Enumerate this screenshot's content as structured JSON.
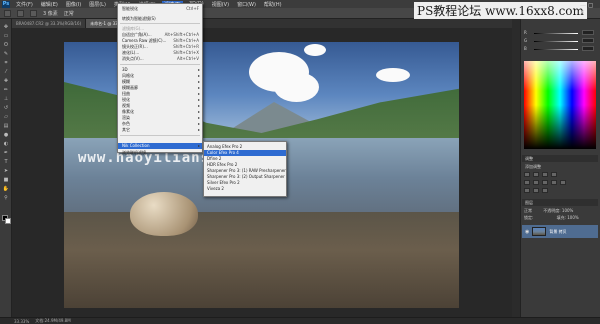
{
  "menubar": {
    "logo": "Ps",
    "items": [
      "文件(F)",
      "编辑(E)",
      "图像(I)",
      "图层(L)",
      "类型(Y)",
      "选择(S)",
      "滤镜(T)",
      "3D(D)",
      "视图(V)",
      "窗口(W)",
      "帮助(H)"
    ]
  },
  "options": {
    "sample_label": "3 像素",
    "size_label": "正常"
  },
  "doc_tabs": [
    "BRA0487.CR2 @ 33.3%(RGB/16)",
    "未命名-1 @ 33.3%(背景 拷贝, RGB/8)"
  ],
  "site_watermark": "PS教程论坛 www.16xx8.com",
  "window_buttons": "— ▢ ✕",
  "filter_menu": {
    "items": [
      {
        "label": "智能锐化",
        "shortcut": "Ctrl+F",
        "disabled": false
      },
      {
        "label": "转换为智能滤镜(S)",
        "shortcut": "",
        "disabled": false
      },
      {
        "label": "滤镜库(G)...",
        "shortcut": "",
        "disabled": true
      },
      {
        "label": "自适应广角(A)...",
        "shortcut": "Alt+Shift+Ctrl+A",
        "disabled": false
      },
      {
        "label": "Camera Raw 滤镜(C)...",
        "shortcut": "Shift+Ctrl+A",
        "disabled": false
      },
      {
        "label": "镜头校正(R)...",
        "shortcut": "Shift+Ctrl+R",
        "disabled": false
      },
      {
        "label": "液化(L)...",
        "shortcut": "Shift+Ctrl+X",
        "disabled": false
      },
      {
        "label": "消失点(V)...",
        "shortcut": "Alt+Ctrl+V",
        "disabled": false
      },
      {
        "label": "3D",
        "arrow": true
      },
      {
        "label": "风格化",
        "arrow": true
      },
      {
        "label": "模糊",
        "arrow": true
      },
      {
        "label": "模糊画廊",
        "arrow": true
      },
      {
        "label": "扭曲",
        "arrow": true
      },
      {
        "label": "锐化",
        "arrow": true
      },
      {
        "label": "视频",
        "arrow": true
      },
      {
        "label": "像素化",
        "arrow": true
      },
      {
        "label": "渲染",
        "arrow": true
      },
      {
        "label": "杂色",
        "arrow": true
      },
      {
        "label": "其它",
        "arrow": true
      },
      {
        "label": "Nik Collection",
        "arrow": true,
        "highlight": true
      },
      {
        "label": "浏览联机滤镜...",
        "shortcut": "",
        "disabled": false
      }
    ]
  },
  "nik_submenu": {
    "items": [
      {
        "label": "Analog Efex Pro 2",
        "highlight": false
      },
      {
        "label": "Color Efex Pro 4",
        "highlight": true
      },
      {
        "label": "Dfine 2",
        "highlight": false
      },
      {
        "label": "HDR Efex Pro 2",
        "highlight": false
      },
      {
        "label": "Sharpener Pro 3: (1) RAW Presharpener",
        "highlight": false
      },
      {
        "label": "Sharpener Pro 3: (2) Output Sharpener",
        "highlight": false
      },
      {
        "label": "Silver Efex Pro 2",
        "highlight": false
      },
      {
        "label": "Viveza 2",
        "highlight": false
      }
    ]
  },
  "image_watermark": "www.haoyilianshi.com",
  "color_panel": {
    "sliders": [
      {
        "label": "R"
      },
      {
        "label": "G"
      },
      {
        "label": "B"
      }
    ]
  },
  "panels": {
    "adjustments_tab": "调整",
    "adjustments_title": "添加调整",
    "layers_tab": "图层",
    "blend_mode": "正常",
    "opacity_label": "不透明度: 100%",
    "lock_label": "锁定:",
    "fill_label": "填充: 100%",
    "layer_name": "背景 拷贝"
  },
  "status": {
    "zoom": "33.33%",
    "doc_info": "文档:24.9M/49.8M"
  }
}
